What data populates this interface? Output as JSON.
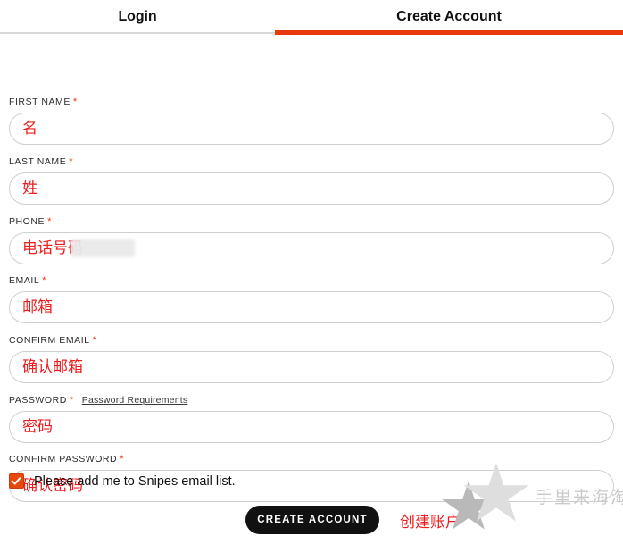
{
  "tabs": [
    {
      "id": "login",
      "label": "Login",
      "active": false
    },
    {
      "id": "create-account",
      "label": "Create Account",
      "active": true
    }
  ],
  "colors": {
    "accent": "#e8380d",
    "checkbox": "#e8490d",
    "annotation_text": "#ee1c1c",
    "button_bg": "#111111",
    "input_border": "#cfcfcf",
    "watermark": "#c9c9c9"
  },
  "form": {
    "required_marker": "*",
    "fields": [
      {
        "name": "first-name",
        "label": "FIRST NAME",
        "required": true,
        "value": "名",
        "blurred": false
      },
      {
        "name": "last-name",
        "label": "LAST NAME",
        "required": true,
        "value": "姓",
        "blurred": false
      },
      {
        "name": "phone",
        "label": "PHONE",
        "required": true,
        "value": "电话号码",
        "blurred": true
      },
      {
        "name": "email",
        "label": "EMAIL",
        "required": true,
        "value": "邮箱",
        "blurred": false
      },
      {
        "name": "confirm-email",
        "label": "CONFIRM EMAIL",
        "required": true,
        "value": "确认邮箱",
        "blurred": false
      },
      {
        "name": "password",
        "label": "PASSWORD",
        "required": true,
        "value": "密码",
        "blurred": false,
        "link": "Password Requirements"
      },
      {
        "name": "confirm-password",
        "label": "CONFIRM PASSWORD",
        "required": true,
        "value": "确认密码",
        "blurred": false
      }
    ]
  },
  "newsletter": {
    "checked": true,
    "label": "Please add me to Snipes email list."
  },
  "submit": {
    "label": "CREATE ACCOUNT",
    "annotation": "创建账户"
  },
  "watermark": {
    "text": "手里来海淘网",
    "icon": "double-star-icon"
  }
}
